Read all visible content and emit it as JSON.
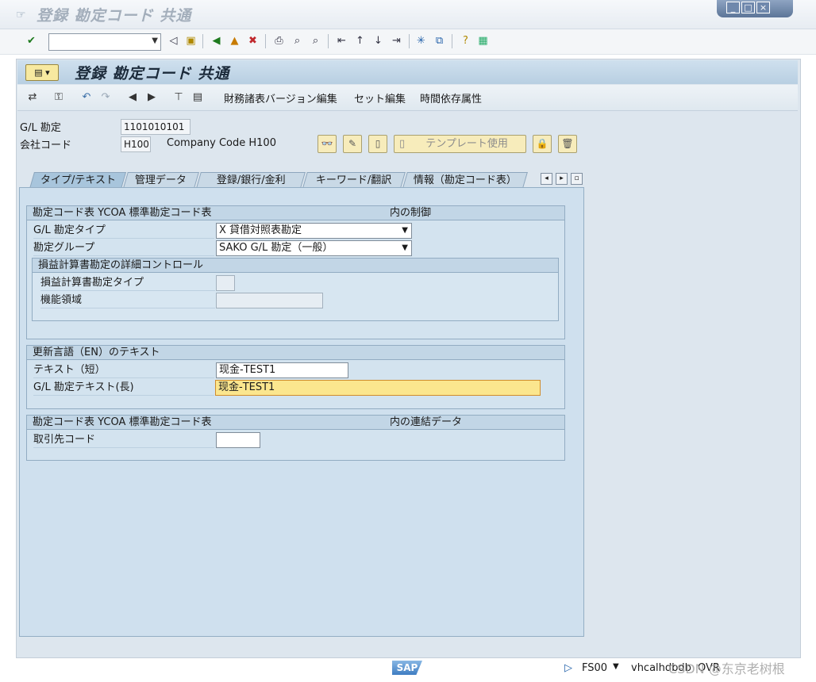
{
  "window": {
    "title": "登録 勘定コード 共通",
    "minimize": "_",
    "maximize": "□",
    "close": "×"
  },
  "system_toolbar": {
    "command_value": ""
  },
  "app": {
    "title": "登録 勘定コード 共通",
    "toolbar": {
      "fs_version_edit": "財務諸表バージョン編集",
      "set_edit": "セット編集",
      "time_dependent": "時間依存属性"
    }
  },
  "header": {
    "gl_account_label": "G/L 勘定",
    "gl_account_value": "1101010101",
    "company_code_label": "会社コード",
    "company_code_value": "H100",
    "company_code_name": "Company Code H100",
    "template_button": "テンプレート使用"
  },
  "tabs": [
    {
      "label": "タイプ/テキスト",
      "active": true
    },
    {
      "label": "管理データ",
      "active": false
    },
    {
      "label": "登録/銀行/金利",
      "active": false
    },
    {
      "label": "キーワード/翻訳",
      "active": false
    },
    {
      "label": "情報（勘定コード表）",
      "active": false
    }
  ],
  "control_group": {
    "title_left": "勘定コード表 YCOA 標準勘定コード表",
    "title_right": "内の制御",
    "account_type_label": "G/L 勘定タイプ",
    "account_type_value": "X 貸借対照表勘定",
    "account_group_label": "勘定グループ",
    "account_group_value": "SAKO G/L 勘定（一般）",
    "pl_detail": {
      "title": "損益計算書勘定の詳細コントロール",
      "pl_type_label": "損益計算書勘定タイプ",
      "pl_type_value": "",
      "functional_area_label": "機能領域",
      "functional_area_value": ""
    }
  },
  "text_group": {
    "title": "更新言語（EN）のテキスト",
    "short_text_label": "テキスト（短）",
    "short_text_value": "现金-TEST1",
    "long_text_label": "G/L 勘定テキスト(長)",
    "long_text_value": "现金-TEST1"
  },
  "consolidation_group": {
    "title_left": "勘定コード表 YCOA 標準勘定コード表",
    "title_right": "内の連結データ",
    "partner_label": "取引先コード",
    "partner_value": ""
  },
  "statusbar": {
    "logo": "SAP",
    "transaction": "FS00",
    "host": "vhcalhdbdb",
    "mode": "OVR",
    "watermark": "CSDN @东京老树根"
  }
}
